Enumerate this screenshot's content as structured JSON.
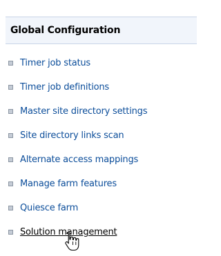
{
  "panel": {
    "title": "Global Configuration"
  },
  "links": [
    {
      "label": "Timer job status"
    },
    {
      "label": "Timer job definitions"
    },
    {
      "label": "Master site directory settings"
    },
    {
      "label": "Site directory links scan"
    },
    {
      "label": "Alternate access mappings"
    },
    {
      "label": "Manage farm features"
    },
    {
      "label": "Quiesce farm"
    },
    {
      "label": "Solution management"
    }
  ],
  "colors": {
    "link": "#0b4d9a",
    "link_hover": "#000000",
    "header_bg": "#f1f5fb",
    "header_border": "#c9d5e7"
  },
  "icons": {
    "bullet": "square-bullet-icon",
    "cursor": "hand-pointer-icon"
  }
}
